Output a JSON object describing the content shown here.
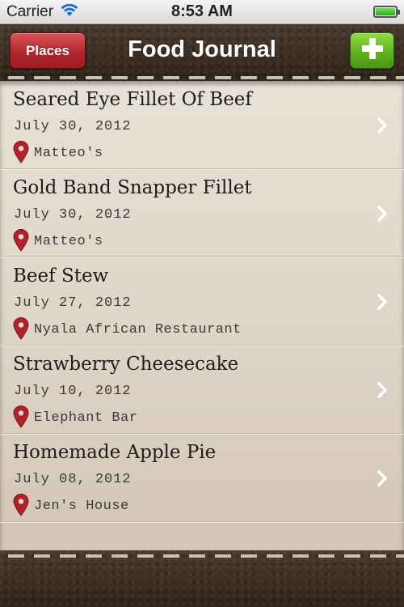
{
  "status_bar": {
    "carrier": "Carrier",
    "time": "8:53 AM"
  },
  "nav": {
    "title": "Food Journal",
    "places_label": "Places",
    "add_icon": "plus-icon"
  },
  "entries": [
    {
      "title": "Seared Eye Fillet Of Beef",
      "date": "July 30, 2012",
      "place": "Matteo's"
    },
    {
      "title": "Gold Band Snapper Fillet",
      "date": "July 30, 2012",
      "place": "Matteo's"
    },
    {
      "title": "Beef Stew",
      "date": "July 27, 2012",
      "place": "Nyala African Restaurant"
    },
    {
      "title": "Strawberry Cheesecake",
      "date": "July 10, 2012",
      "place": "Elephant Bar"
    },
    {
      "title": "Homemade Apple Pie",
      "date": "July 08, 2012",
      "place": "Jen's House"
    }
  ],
  "colors": {
    "places_button": "#b3272e",
    "add_button": "#5fb21f",
    "pin": "#b0232a",
    "leather": "#3a2d23"
  }
}
